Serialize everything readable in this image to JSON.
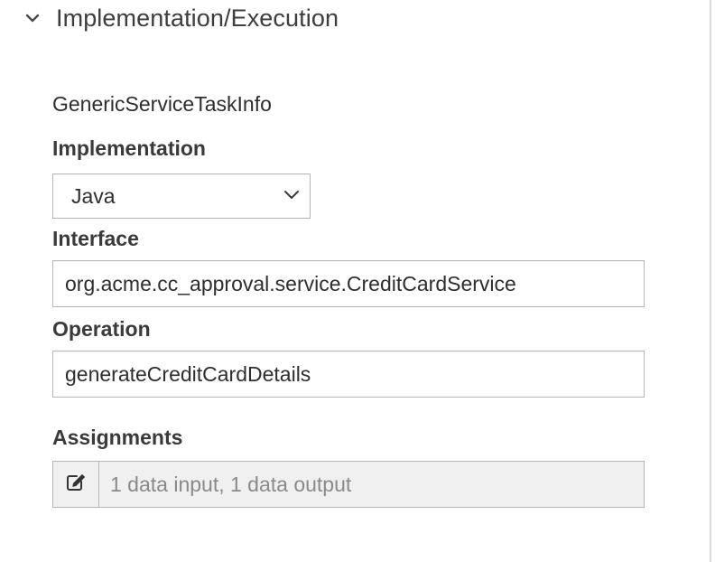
{
  "section": {
    "title": "Implementation/Execution",
    "chevron_icon": "chevron-down-icon"
  },
  "task_info": "GenericServiceTaskInfo",
  "implementation": {
    "label": "Implementation",
    "selected": "Java"
  },
  "interface": {
    "label": "Interface",
    "value": "org.acme.cc_approval.service.CreditCardService"
  },
  "operation": {
    "label": "Operation",
    "value": "generateCreditCardDetails"
  },
  "assignments": {
    "label": "Assignments",
    "value": "1 data input, 1 data output",
    "edit_icon": "edit-icon"
  }
}
